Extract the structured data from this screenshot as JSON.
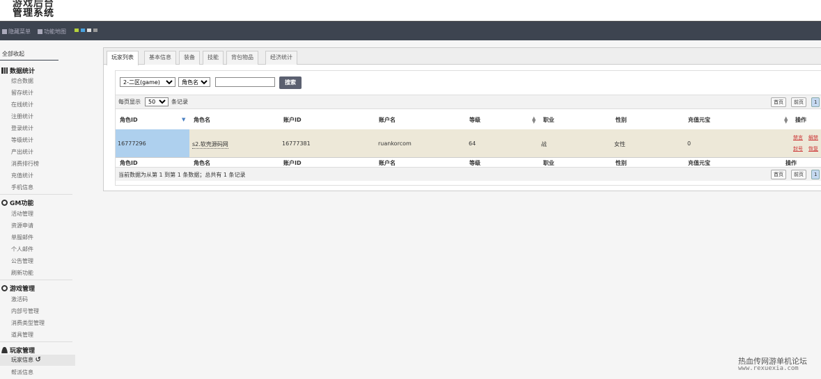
{
  "logo": {
    "line1": "游戏后台",
    "line2": "管理系统"
  },
  "navbar": {
    "hide_menu": "隐藏菜单",
    "feature_map": "功能地图",
    "swatches": [
      "#b5d23c",
      "#4aa3df",
      "#ddd",
      "#999"
    ]
  },
  "sidebar": {
    "collapse_all": "全部收起",
    "groups": [
      {
        "title": "数据统计",
        "items": [
          "综合数据",
          "留存统计",
          "在线统计",
          "注册统计",
          "登录统计",
          "等级统计",
          "产出统计",
          "消费排行榜",
          "充值统计",
          "手机信息"
        ]
      },
      {
        "title": "GM功能",
        "items": [
          "活动管理",
          "资源申请",
          "单服邮件",
          "个人邮件",
          "公告管理",
          "刷新功能"
        ]
      },
      {
        "title": "游戏管理",
        "items": [
          "激活码",
          "内部号管理",
          "消费类型管理",
          "道具管理"
        ]
      },
      {
        "title": "玩家管理",
        "items": [
          "玩家信息",
          "帮派信息"
        ]
      }
    ]
  },
  "tabs": [
    "玩家列表",
    "基本信息",
    "装备",
    "技能",
    "背包物品",
    "经济统计"
  ],
  "search": {
    "server": "2-二区(game)",
    "field": "角色名",
    "value": "",
    "button": "搜索"
  },
  "pager": {
    "per_page_label": "每页显示",
    "per_page": "50",
    "per_page_suffix": "条记录",
    "first": "首页",
    "prev": "前页",
    "page": "1"
  },
  "table": {
    "headers": [
      "角色ID",
      "角色名",
      "账户ID",
      "账户名",
      "等级",
      "职业",
      "性别",
      "充值元宝",
      "操作"
    ],
    "rows": [
      {
        "role_id": "16777296",
        "role_name": "s2.软壳源码网",
        "account_id": "16777381",
        "account_name": "ruankorcom",
        "level": "64",
        "job": "战",
        "gender": "女性",
        "recharge": "0",
        "ops": [
          "禁言",
          "解禁",
          "封号",
          "恢复"
        ]
      }
    ]
  },
  "info": "当前数据为从第 1 到第 1 条数据；总共有 1 条记录",
  "watermark": {
    "line1": "热血传网游单机论坛",
    "line2": "www.rexuexia.com"
  }
}
